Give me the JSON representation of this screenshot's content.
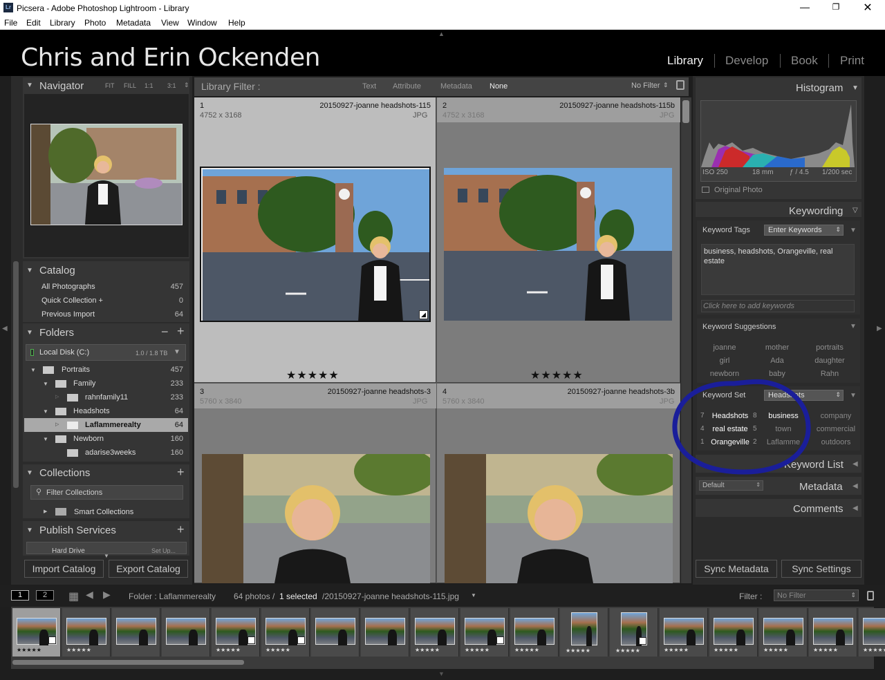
{
  "window": {
    "title": "Picsera - Adobe Photoshop Lightroom - Library",
    "app_icon": "Lr"
  },
  "menu": [
    "File",
    "Edit",
    "Library",
    "Photo",
    "Metadata",
    "View",
    "Window",
    "Help"
  ],
  "identity_plate": "Chris and Erin Ockenden",
  "modules": [
    "Library",
    "Develop",
    "Book",
    "Print"
  ],
  "navigator": {
    "title": "Navigator",
    "zoom": [
      "FIT",
      "FILL",
      "1:1",
      "3:1"
    ]
  },
  "catalog": {
    "title": "Catalog",
    "items": [
      {
        "label": "All Photographs",
        "count": "457"
      },
      {
        "label": "Quick Collection  +",
        "count": "0"
      },
      {
        "label": "Previous Import",
        "count": "64"
      }
    ]
  },
  "folders": {
    "title": "Folders",
    "volume": "Local Disk (C:)",
    "volume_size": "1.0 / 1.8 TB",
    "items": [
      {
        "label": "Portraits",
        "count": "457"
      },
      {
        "label": "Family",
        "count": "233"
      },
      {
        "label": "rahnfamily11",
        "count": "233"
      },
      {
        "label": "Headshots",
        "count": "64"
      },
      {
        "label": "Laflammerealty",
        "count": "64"
      },
      {
        "label": "Newborn",
        "count": "160"
      },
      {
        "label": "adarise3weeks",
        "count": "160"
      }
    ]
  },
  "collections": {
    "title": "Collections",
    "filter": "Filter Collections",
    "smart": "Smart Collections"
  },
  "publish": {
    "title": "Publish Services",
    "hard_drive": "Hard Drive",
    "setup": "Set Up..."
  },
  "buttons": {
    "import": "Import Catalog",
    "export": "Export Catalog",
    "sync_meta": "Sync Metadata",
    "sync_settings": "Sync Settings"
  },
  "filterbar": {
    "title": "Library Filter :",
    "options": [
      "Text",
      "Attribute",
      "Metadata",
      "None"
    ],
    "preset": "No Filter"
  },
  "grid": [
    {
      "num": "1",
      "name": "20150927-joanne headshots-115",
      "dims": "4752 x 3168",
      "ext": "JPG",
      "stars": "★★★★★"
    },
    {
      "num": "2",
      "name": "20150927-joanne headshots-115b",
      "dims": "4752 x 3168",
      "ext": "JPG",
      "stars": "★★★★★"
    },
    {
      "num": "3",
      "name": "20150927-joanne headshots-3",
      "dims": "5760 x 3840",
      "ext": "JPG",
      "stars": ""
    },
    {
      "num": "4",
      "name": "20150927-joanne headshots-3b",
      "dims": "5760 x 3840",
      "ext": "JPG",
      "stars": ""
    }
  ],
  "histogram": {
    "title": "Histogram",
    "iso": "ISO 250",
    "focal": "18 mm",
    "aperture": "ƒ / 4.5",
    "shutter": "1/200 sec",
    "original": "Original Photo"
  },
  "keywording": {
    "title": "Keywording",
    "tags_label": "Keyword Tags",
    "tags_mode": "Enter Keywords",
    "tags_text": "business, headshots, Orangeville, real estate",
    "placeholder": "Click here to add keywords",
    "suggestions_title": "Keyword Suggestions",
    "suggestions": [
      "joanne",
      "mother",
      "portraits",
      "girl",
      "Ada",
      "daughter",
      "newborn",
      "baby",
      "Rahn"
    ],
    "set_label": "Keyword Set",
    "set_value": "Headshots",
    "set": [
      {
        "n": "7",
        "k": "Headshots"
      },
      {
        "n": "8",
        "k": "business"
      },
      {
        "n": "",
        "k": "company"
      },
      {
        "n": "4",
        "k": "real estate"
      },
      {
        "n": "5",
        "k": "town"
      },
      {
        "n": "",
        "k": "commercial"
      },
      {
        "n": "1",
        "k": "Orangeville"
      },
      {
        "n": "2",
        "k": "Laflamme"
      },
      {
        "n": "",
        "k": "outdoors"
      }
    ]
  },
  "keyword_list": "Keyword List",
  "metadata": {
    "title": "Metadata",
    "preset": "Default"
  },
  "comments": "Comments",
  "filmstrip": {
    "page1": "1",
    "page2": "2",
    "source": "Folder : Laflammerealty",
    "count": "64 photos /",
    "selected": "1 selected",
    "file": "/20150927-joanne headshots-115.jpg",
    "filter_label": "Filter :",
    "filter_value": "No Filter"
  },
  "colors": {
    "accent_circle": "#1a1e9a",
    "panel": "#353535",
    "grid": "#5a5a5a"
  }
}
